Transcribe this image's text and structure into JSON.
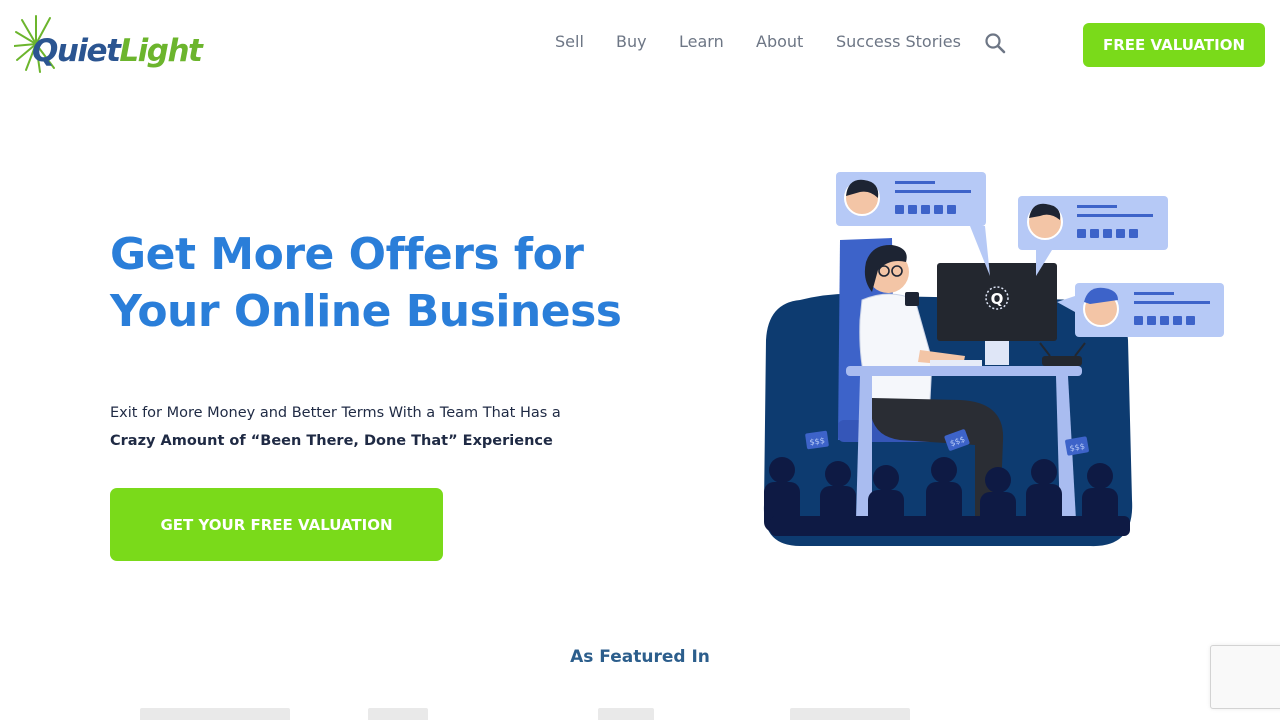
{
  "brand": {
    "name_part1": "Quiet",
    "name_part2": "Light"
  },
  "nav": {
    "items": [
      {
        "label": "Sell"
      },
      {
        "label": "Buy"
      },
      {
        "label": "Learn"
      },
      {
        "label": "About"
      },
      {
        "label": "Success Stories"
      }
    ],
    "search_icon": "search-icon",
    "cta_label": "FREE VALUATION"
  },
  "hero": {
    "headline_line1": "Get More Offers for",
    "headline_line2": "Your Online Business",
    "sub_line1": "Exit for More Money and Better Terms With a Team That Has a",
    "sub_line2": "Crazy Amount of “Been There, Done That” Experience",
    "cta_label": "GET YOUR FREE VALUATION",
    "monitor_mark": "Q",
    "sign_text": "$$$"
  },
  "featured": {
    "heading": "As Featured In"
  },
  "colors": {
    "accent_green": "#7ada1a",
    "headline_blue": "#2a7ed9",
    "logo_blue": "#2b5591",
    "logo_green": "#6cb52d",
    "navy": "#0d3b70",
    "card_blue": "#b6c9f6"
  }
}
